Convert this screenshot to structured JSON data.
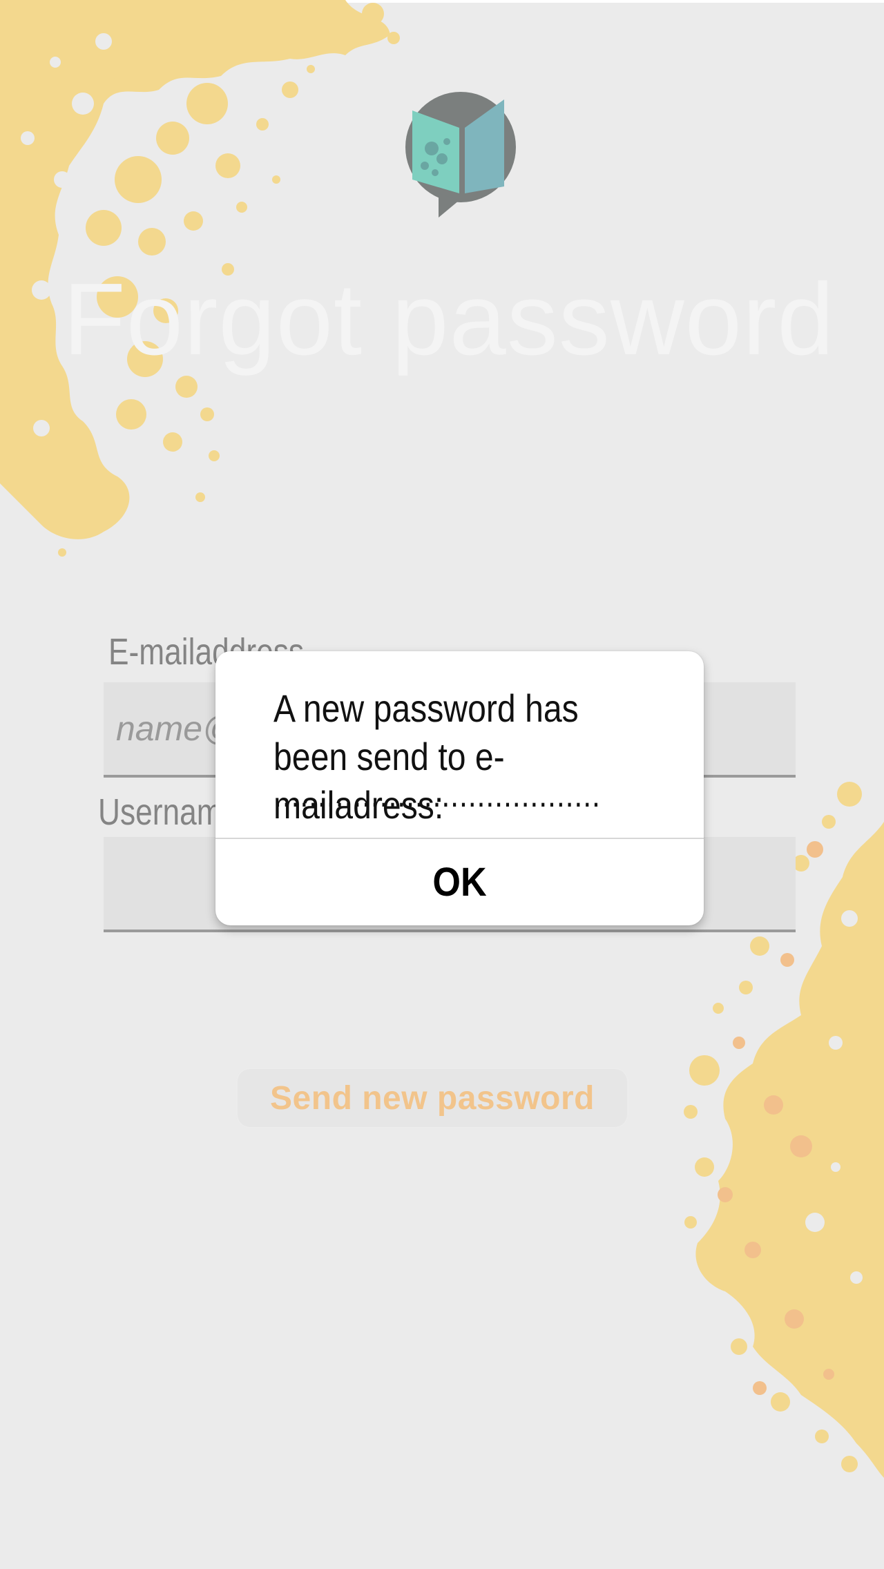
{
  "screen": {
    "title": "Forgot password"
  },
  "form": {
    "email_label": "E-mailaddress",
    "email_placeholder": "name@",
    "username_label": "Username",
    "username_value": ""
  },
  "actions": {
    "send_button_label": "Send new password"
  },
  "dialog": {
    "message": "A new password has been send to e-mailadress:",
    "placeholder_dots": ".....................................",
    "ok_label": "OK"
  },
  "icons": {
    "logo": "book-chat-logo-icon",
    "decor_top_left": "yellow-splash-decoration",
    "decor_bottom_right": "yellow-splash-decoration"
  },
  "colors": {
    "background": "#ebebeb",
    "splash_yellow": "#f3d88e",
    "splash_orange": "#f2c08c",
    "logo_grey": "#7b7f7e",
    "logo_teal": "#7ecfbf",
    "button_text": "#f2c48b",
    "dialog_background": "#ffffff"
  }
}
